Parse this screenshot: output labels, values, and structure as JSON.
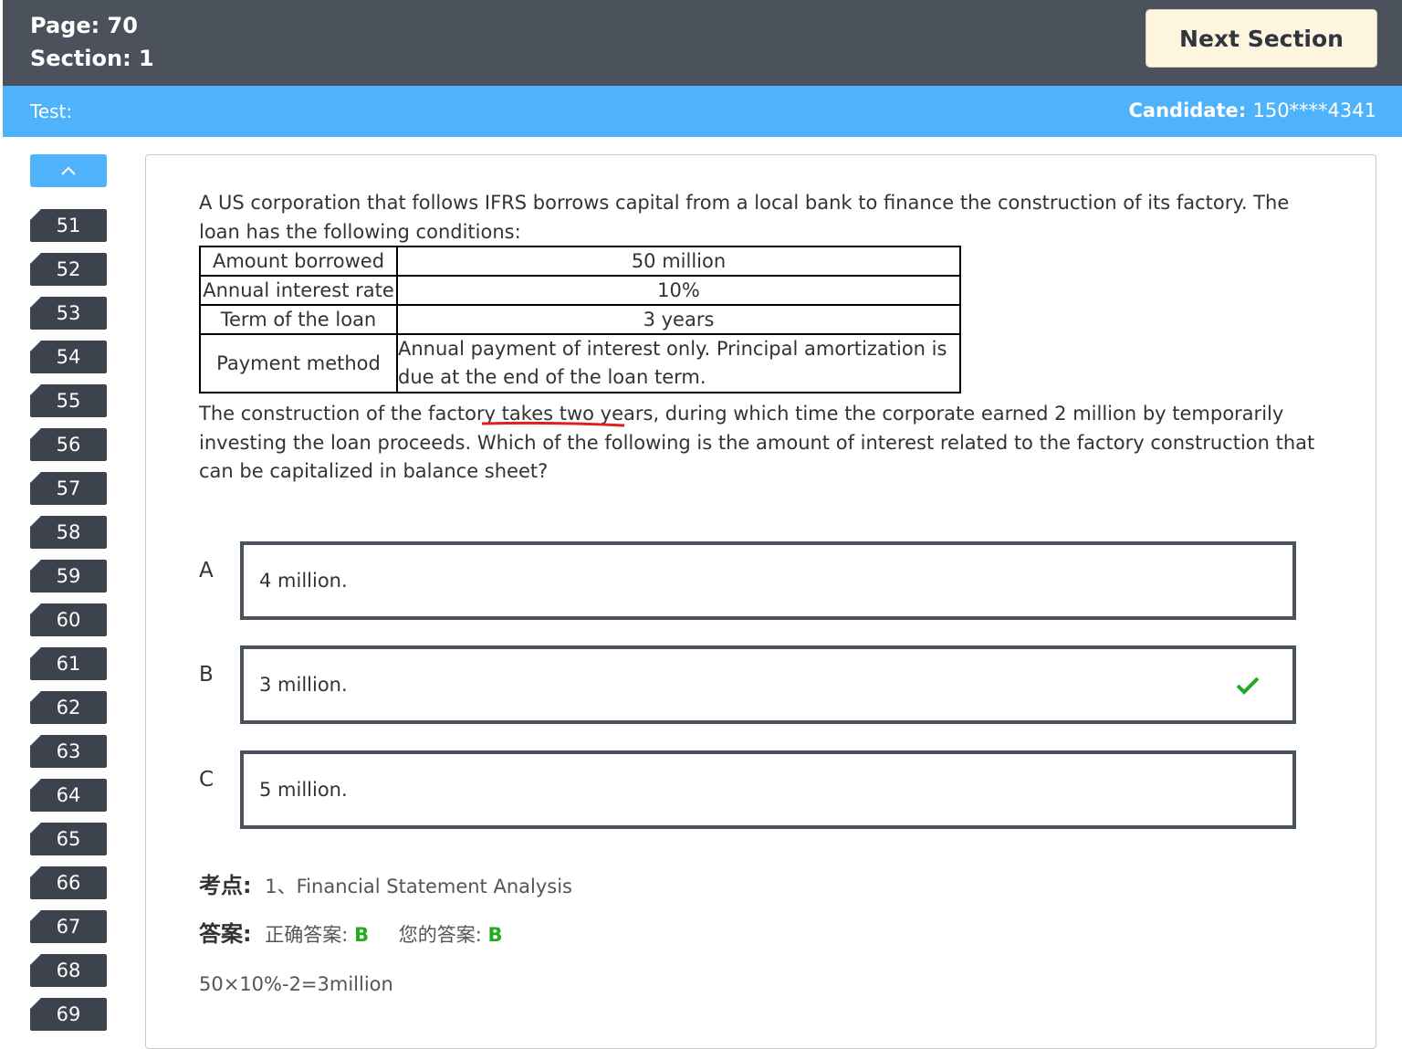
{
  "header": {
    "page_label": "Page: 70",
    "section_label": "Section: 1",
    "next_button": "Next Section"
  },
  "subheader": {
    "test_label": "Test:",
    "candidate_label": "Candidate",
    "candidate_sep": ":  ",
    "candidate_id": "150****4341"
  },
  "sidebar": {
    "up_icon": "chevron-up-icon",
    "questions": [
      "51",
      "52",
      "53",
      "54",
      "55",
      "56",
      "57",
      "58",
      "59",
      "60",
      "61",
      "62",
      "63",
      "64",
      "65",
      "66",
      "67",
      "68",
      "69"
    ]
  },
  "question": {
    "intro": "A US corporation that follows IFRS borrows capital from a local bank to finance the construction of its factory. The loan has the following conditions:",
    "table": [
      {
        "label": "Amount borrowed",
        "value": "50 million"
      },
      {
        "label": "Annual interest rate",
        "value": "10%"
      },
      {
        "label": "Term of the loan",
        "value": "3 years"
      },
      {
        "label": "Payment method",
        "value": "Annual payment of interest only. Principal amortization is due at the end of the loan term."
      }
    ],
    "body": "The construction of the factory takes two years, during which time the corporate earned 2 million by temporarily investing the loan proceeds. Which of the following is the amount of interest related to the factory construction that can be capitalized in balance sheet?"
  },
  "options": [
    {
      "letter": "A",
      "text": "4 million."
    },
    {
      "letter": "B",
      "text": "3 million.",
      "selected_icon": "check-icon"
    },
    {
      "letter": "C",
      "text": "5 million."
    }
  ],
  "analysis": {
    "topic_label": "考点:",
    "topic_value": "1、Financial Statement Analysis",
    "answer_label": "答案:",
    "correct_label": "正确答案:",
    "correct_value": "B",
    "your_label": "您的答案:",
    "your_value": "B",
    "explanation": "50×10%-2=3million"
  },
  "colors": {
    "header_bg": "#4c525c",
    "subheader_bg": "#4fb3fb",
    "button_bg": "#fdf5de",
    "correct_green": "#22aa22",
    "annotation_red": "#e02020"
  }
}
